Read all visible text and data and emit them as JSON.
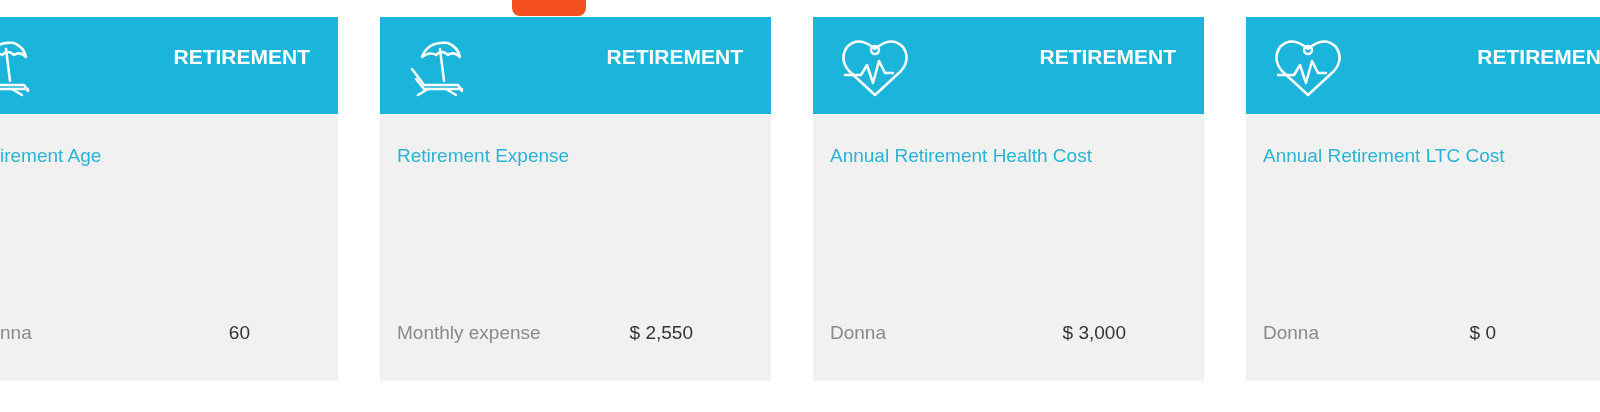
{
  "cards": [
    {
      "kind": "beach",
      "category": "RETIREMENT",
      "title": "irement Age",
      "label": "nna",
      "value": "60"
    },
    {
      "kind": "beach",
      "category": "RETIREMENT",
      "title": "Retirement Expense",
      "label": "Monthly expense",
      "value": "$ 2,550"
    },
    {
      "kind": "heart",
      "category": "RETIREMENT",
      "title": "Annual Retirement Health Cost",
      "label": "Donna",
      "value": "$ 3,000"
    },
    {
      "kind": "heart",
      "category": "RETIREMEN",
      "title": "Annual Retirement LTC Cost",
      "label": "Donna",
      "value": "$ 0"
    }
  ]
}
